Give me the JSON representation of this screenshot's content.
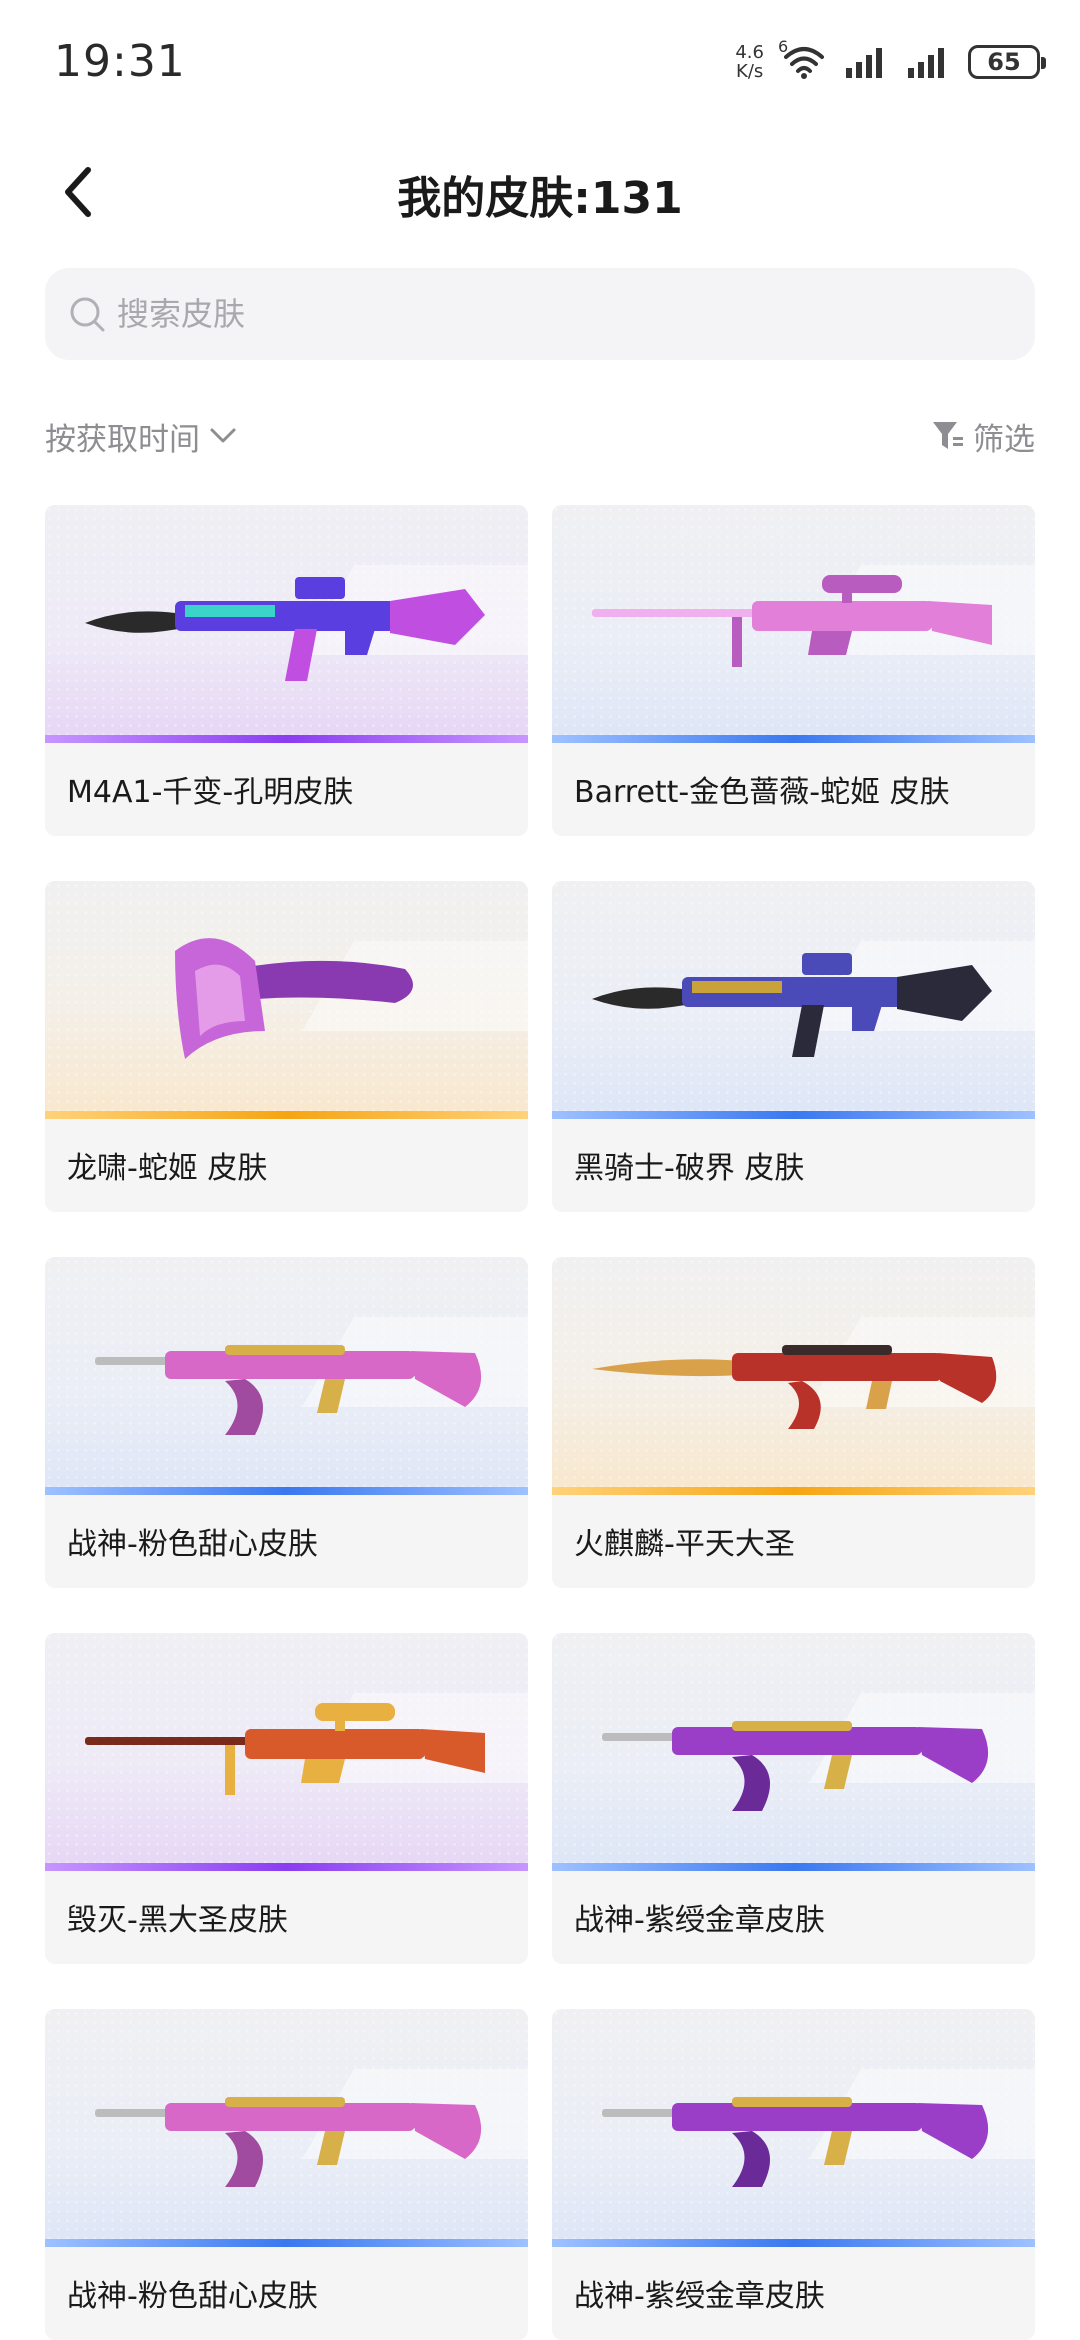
{
  "status_bar": {
    "time": "19:31",
    "net_speed_value": "4.6",
    "net_speed_unit": "K/s",
    "wifi_badge": "6",
    "battery": "65"
  },
  "header": {
    "title": "我的皮肤:131"
  },
  "search": {
    "placeholder": "搜索皮肤"
  },
  "toolbar": {
    "sort_label": "按获取时间",
    "filter_label": "筛选"
  },
  "colors": {
    "purple": "#8a3cf0",
    "blue": "#3a78f0",
    "orange": "#f5a512"
  },
  "skins": [
    {
      "name": "M4A1-千变-孔明皮肤",
      "rarity": "purple",
      "weapon": "rifle-m4",
      "palette": [
        "#3ad4c8",
        "#5a3ee0",
        "#c04ee0"
      ]
    },
    {
      "name": "Barrett-金色蔷薇-蛇姬 皮肤",
      "rarity": "blue",
      "weapon": "sniper",
      "palette": [
        "#e27fd8",
        "#b85cc0",
        "#f0b0f0"
      ]
    },
    {
      "name": "龙啸-蛇姬 皮肤",
      "rarity": "orange",
      "weapon": "axe",
      "palette": [
        "#c766d8",
        "#8a3ab0",
        "#f1b4f0"
      ]
    },
    {
      "name": "黑骑士-破界 皮肤",
      "rarity": "blue",
      "weapon": "rifle-m4",
      "palette": [
        "#c9a23a",
        "#4a4ab8",
        "#2a2a3a"
      ]
    },
    {
      "name": "战神-粉色甜心皮肤",
      "rarity": "blue",
      "weapon": "ak",
      "palette": [
        "#d868c8",
        "#d7b04a",
        "#a04aa0"
      ]
    },
    {
      "name": "火麒麟-平天大圣",
      "rarity": "orange",
      "weapon": "ak-blade",
      "palette": [
        "#b8322a",
        "#d9a24a",
        "#3a2a2a"
      ]
    },
    {
      "name": "毁灭-黑大圣皮肤",
      "rarity": "purple",
      "weapon": "sniper",
      "palette": [
        "#d85a2a",
        "#e8b040",
        "#7a2a1a"
      ]
    },
    {
      "name": "战神-紫绶金章皮肤",
      "rarity": "blue",
      "weapon": "ak",
      "palette": [
        "#9a3ec8",
        "#d8b048",
        "#6a2a98"
      ]
    },
    {
      "name": "战神-粉色甜心皮肤",
      "rarity": "blue",
      "weapon": "ak",
      "palette": [
        "#d868c8",
        "#d7b04a",
        "#a04aa0"
      ]
    },
    {
      "name": "战神-紫绶金章皮肤",
      "rarity": "blue",
      "weapon": "ak",
      "palette": [
        "#9a3ec8",
        "#d8b048",
        "#6a2a98"
      ]
    }
  ]
}
